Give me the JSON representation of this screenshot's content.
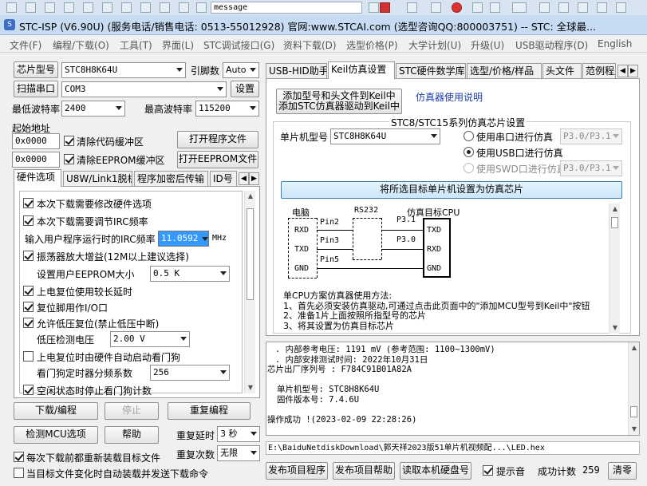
{
  "window": {
    "title": "STC-ISP (V6.90U) (服务电话/销售电话: 0513-55012928) 官网:www.STCAI.com  (选型咨询QQ:800003751) -- STC: 全球最..."
  },
  "top_strip": {
    "message_input": "message"
  },
  "menu": [
    "文件(F)",
    "编程/下载(O)",
    "工具(T)",
    "界面(L)",
    "STC调试接口(G)",
    "资料下载(D)",
    "选型价格(P)",
    "大学计划(U)",
    "升级(U)",
    "USB驱动程序(D)",
    "English"
  ],
  "left": {
    "chip_btn": "芯片型号",
    "chip_model": "STC8H8K64U",
    "pin_label": "引脚数",
    "pin_value": "Auto",
    "scan_btn": "扫描串口",
    "com_port": "COM3",
    "settings_btn": "设置",
    "min_baud_label": "最低波特率",
    "min_baud": "2400",
    "max_baud_label": "最高波特率",
    "max_baud": "115200",
    "start_addr_label": "起始地址",
    "addr1": "0x0000",
    "clear_code": "清除代码缓冲区",
    "open_prog": "打开程序文件",
    "addr2": "0x0000",
    "clear_eeprom": "清除EEPROM缓冲区",
    "open_eeprom": "打开EEPROM文件",
    "tabs": [
      "硬件选项",
      "U8W/Link1脱机",
      "程序加密后传输",
      "ID号"
    ],
    "options": {
      "opt1": "本次下载需要修改硬件选项",
      "opt2": "本次下载需要调节IRC频率",
      "irc_label": "输入用户程序运行时的IRC频率",
      "irc_value": "11.0592",
      "irc_unit": "MHz",
      "opt3": "振荡器放大增益(12M以上建议选择)",
      "eeprom_label": "设置用户EEPROM大小",
      "eeprom_value": "0.5 K",
      "opt4": "上电复位使用较长延时",
      "opt5": "复位脚用作I/O口",
      "opt6": "允许低压复位(禁止低压中断)",
      "lvd_label": "低压检测电压",
      "lvd_value": "2.00 V",
      "opt7": "上电复位时由硬件自动启动看门狗",
      "wdt_label": "看门狗定时器分频系数",
      "wdt_value": "256",
      "opt8": "空闲状态时停止看门狗计数"
    },
    "download_btn": "下载/编程",
    "stop_btn": "停止",
    "reprog_btn": "重复编程",
    "detect_btn": "检测MCU选项",
    "help_btn": "帮助",
    "repeat_delay_label": "重复延时",
    "repeat_delay": "3 秒",
    "repeat_count_label": "重复次数",
    "repeat_count": "无限",
    "reload_label": "每次下载前都重新装载目标文件",
    "auto_send_label": "当目标文件变化时自动装载并发送下载命令"
  },
  "right": {
    "tabs": [
      "USB-HID助手",
      "Keil仿真设置",
      "STC硬件数学库",
      "选型/价格/样品",
      "头文件",
      "范例程序"
    ],
    "keil": {
      "add_btn_line1": "添加型号和头文件到Keil中",
      "add_btn_line2": "添加STC仿真器驱动到Keil中",
      "emu_link": "仿真器使用说明",
      "group_title": "STC8/STC15系列仿真芯片设置",
      "mcu_label": "单片机型号",
      "mcu_value": "STC8H8K64U",
      "r_serial": "使用串口进行仿真",
      "r_usb": "使用USB口进行仿真",
      "r_swd": "使用SWD口进行仿真",
      "port1": "P3.0/P3.1",
      "port2": "P3.0/P3.1",
      "set_btn": "将所选目标单片机设置为仿真芯片",
      "diagram": {
        "pc": "电脑",
        "rs232": "RS232",
        "target": "仿真目标CPU",
        "rxd": "RXD",
        "txd": "TXD",
        "gnd": "GND",
        "pin2": "Pin2",
        "pin3": "Pin3",
        "pin5": "Pin5",
        "p31": "P3.1",
        "p30": "P3.0",
        "t_txd": "TXD",
        "t_rxd": "RXD",
        "t_gnd": "GND"
      },
      "notes": [
        "单CPU方案仿真器使用方法:",
        "1、首先必须安装仿真驱动,可通过点击此页面中的\"添加MCU型号到Keil中\"按钮",
        "2、准备1片上面按照所指型号的芯片",
        "3、将其设置为仿真目标芯片"
      ]
    },
    "log": [
      ". 内部参考电压: 1191 mV (参考范围: 1100~1300mV)",
      ". 内部安排测试时间: 2022年10月31日",
      "芯片出厂序列号 : F784C91B01A82A",
      "",
      "单片机型号: STC8H8K64U",
      "固件版本号: 7.4.6U",
      "",
      "操作成功 !(2023-02-09 22:28:26)"
    ],
    "file_path": "E:\\BaiduNetdiskDownload\\郭天祥2023版51单片机视频配...\\LED.hex",
    "publish_btn": "发布项目程序",
    "publish_help_btn": "发布项目帮助",
    "read_disk_btn": "读取本机硬盘号",
    "beep_label": "提示音",
    "count_label": "成功计数",
    "count_value": "259",
    "clear_btn": "清零"
  },
  "colors": {
    "title_bg": "#c7dcf2",
    "link": "#1e3ea8",
    "highlight_btn": "#d8ecfb",
    "select_bg": "#3399ff"
  }
}
